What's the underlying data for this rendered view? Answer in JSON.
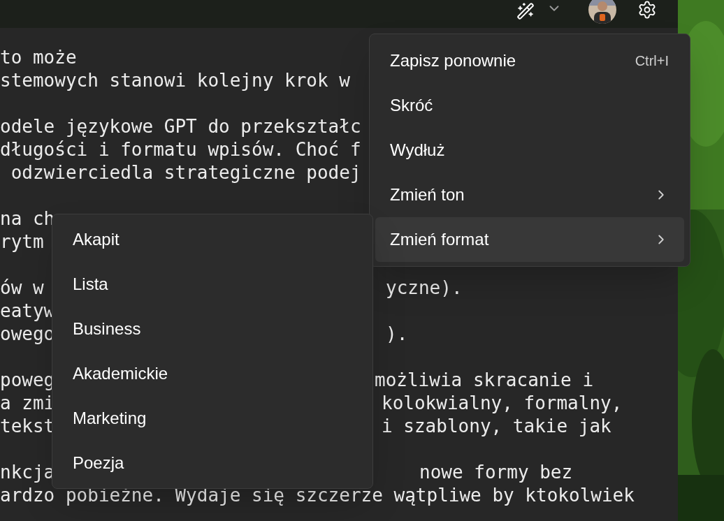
{
  "editor": {
    "paragraphs": [
      {
        "lines": [
          {
            "left": "to może"
          },
          {
            "left": "stemowych stanowi kolejny krok w"
          }
        ]
      },
      {
        "lines": [
          {
            "left": "odele językowe GPT do przekształc"
          },
          {
            "left": "długości i formatu wpisów. Choć f"
          },
          {
            "left": " odzwierciedla strategiczne podej"
          }
        ]
      },
      {
        "lines": [
          {
            "left": "na ch"
          },
          {
            "left": "rytm"
          }
        ]
      },
      {
        "lines": [
          {
            "left": "ów w",
            "right": "yczne)."
          },
          {
            "left": "eatyw"
          },
          {
            "left": "owego",
            "right": ")."
          }
        ]
      },
      {
        "lines": [
          {
            "left": "poweg",
            "right": "możliwia skracanie i"
          },
          {
            "left": "a zmi",
            "right": "kolokwialny, formalny,"
          },
          {
            "left": "tekst",
            "right": "i szablony, takie jak"
          }
        ]
      },
      {
        "lines": [
          {
            "left": "nkcja",
            "right": "nowe formy bez"
          },
          {
            "left": "ardzo pobieżne. Wydaje się szczerze wątpliwe by ktokolwiek"
          }
        ]
      }
    ]
  },
  "context_menu": {
    "items": [
      {
        "label": "Zapisz ponownie",
        "shortcut": "Ctrl+I",
        "submenu": false,
        "selected": false
      },
      {
        "label": "Skróć",
        "submenu": false,
        "selected": false
      },
      {
        "label": "Wydłuż",
        "submenu": false,
        "selected": false
      },
      {
        "label": "Zmień ton",
        "submenu": true,
        "selected": false
      },
      {
        "label": "Zmień format",
        "submenu": true,
        "selected": true
      }
    ]
  },
  "submenu": {
    "items": [
      {
        "label": "Akapit",
        "selected": false
      },
      {
        "label": "Lista",
        "selected": false
      },
      {
        "label": "Business",
        "selected": false
      },
      {
        "label": "Akademickie",
        "selected": false
      },
      {
        "label": "Marketing",
        "selected": false
      },
      {
        "label": "Poezja",
        "selected": false
      }
    ]
  }
}
